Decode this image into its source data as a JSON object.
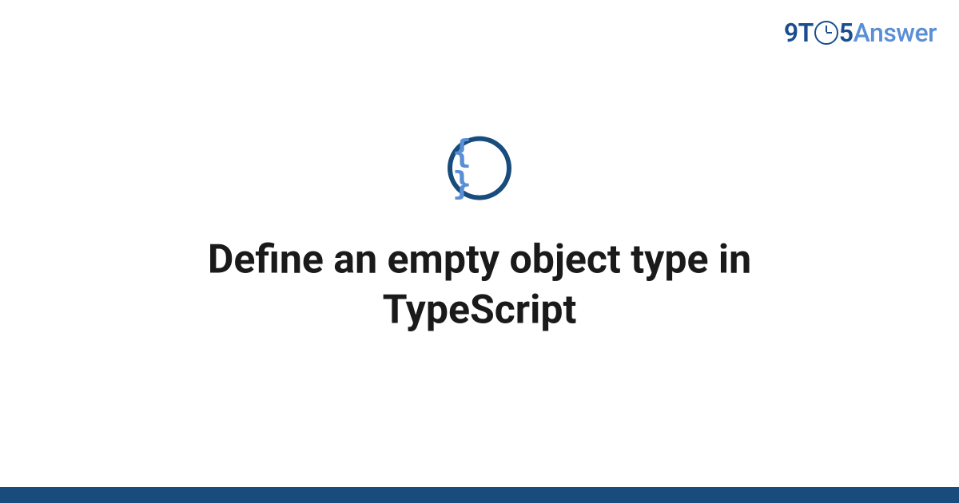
{
  "logo": {
    "part1": "9T",
    "part2": "5",
    "part3": "Answer"
  },
  "icon": {
    "braces": "{ }"
  },
  "title": "Define an empty object type in TypeScript",
  "colors": {
    "primary": "#184c7c",
    "accent": "#5a8fd6"
  }
}
